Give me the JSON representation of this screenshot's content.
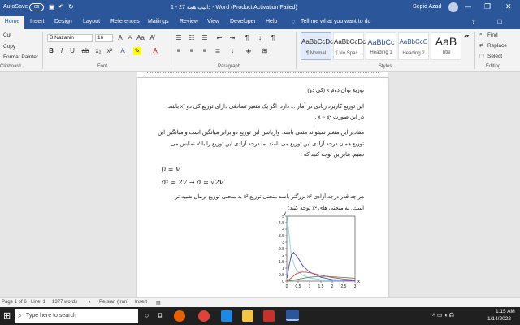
{
  "window": {
    "autosave_label": "AutoSave",
    "autosave_state": "Off",
    "title": "1 - ذاتیب همه 27 - Word (Product Activation Failed)",
    "user": "Sepid Azad"
  },
  "tabs": [
    "Home",
    "Insert",
    "Design",
    "Layout",
    "References",
    "Mailings",
    "Review",
    "View",
    "Developer",
    "Help"
  ],
  "tell_me": "Tell me what you want to do",
  "clipboard": {
    "cut": "Cut",
    "copy": "Copy",
    "format_painter": "Format Painter",
    "group": "Clipboard"
  },
  "font": {
    "name": "B Nazanin",
    "size": "16",
    "group": "Font"
  },
  "paragraph": {
    "group": "Paragraph"
  },
  "styles": {
    "group": "Styles",
    "items": [
      {
        "preview": "AaBbCcDc",
        "name": "¶ Normal"
      },
      {
        "preview": "AaBbCcDc",
        "name": "¶ No Spac..."
      },
      {
        "preview": "AaBbCc",
        "name": "Heading 1"
      },
      {
        "preview": "AaBbCcC",
        "name": "Heading 2"
      },
      {
        "preview": "AaB",
        "name": "Title"
      }
    ]
  },
  "editing": {
    "find": "Find",
    "replace": "Replace",
    "select": "Select",
    "group": "Editing"
  },
  "document": {
    "heading": "توزیع توان دوم k (کی دو)",
    "p1_line1": "این توزیع کاربرد زیادی در آمار ... دارد. اگر یک متغیر تصادفی دارای توزیع کی دو x² باشد",
    "p1_line2": "در این صورت x ~ χ² .",
    "p2_line1": "مقادیر این متغیر نمیتواند منفی باشد. واریانس این توزیع دو برابر میانگین است و میانگین این",
    "p2_line2": "توزیع همان درجه آزادی این توزیع می نامند. ما درجه آزادی این توزیع را با V نمایش می",
    "p2_line3": "دهیم. بنابراین توجه کنید که :",
    "eq1": "μ = V",
    "eq2": "σ² = 2V  →  σ = √2V",
    "p3_line1": "هر چه قدر درجه آزادی x² بزرگتر باشد منحنی توزیع x² به منحنی توزیع نرمال شبیه تر",
    "p3_line2": "است. به منحنی های x² توجه کنید:"
  },
  "chart_data": {
    "type": "line",
    "ylabel": "y",
    "xlabel": "x",
    "ylim": [
      0,
      5
    ],
    "xlim": [
      0,
      3
    ],
    "y_ticks": [
      "0",
      "0.5",
      "1",
      "1.5",
      "2",
      "2.5",
      "3",
      "3.5",
      "4",
      "4.5",
      "5"
    ],
    "x_ticks": [
      "0",
      "0.5",
      "1",
      "1.5",
      "2",
      "2.5",
      "3"
    ],
    "series": [
      {
        "color": "#7fd6e8",
        "values": [
          [
            0.02,
            5
          ],
          [
            0.1,
            3.6
          ],
          [
            0.2,
            1.9
          ],
          [
            0.4,
            0.9
          ],
          [
            0.7,
            0.45
          ],
          [
            1,
            0.25
          ],
          [
            1.5,
            0.12
          ],
          [
            2,
            0.06
          ],
          [
            3,
            0.02
          ]
        ]
      },
      {
        "color": "#3f48cc",
        "values": [
          [
            0.02,
            0.3
          ],
          [
            0.1,
            1.2
          ],
          [
            0.2,
            2.0
          ],
          [
            0.3,
            2.2
          ],
          [
            0.45,
            1.9
          ],
          [
            0.7,
            1.2
          ],
          [
            1,
            0.7
          ],
          [
            1.5,
            0.3
          ],
          [
            2,
            0.12
          ],
          [
            3,
            0.02
          ]
        ]
      },
      {
        "color": "#e04848",
        "values": [
          [
            0,
            0
          ],
          [
            0.2,
            0.25
          ],
          [
            0.4,
            0.55
          ],
          [
            0.6,
            0.68
          ],
          [
            0.8,
            0.7
          ],
          [
            1.1,
            0.62
          ],
          [
            1.5,
            0.45
          ],
          [
            2,
            0.28
          ],
          [
            2.5,
            0.16
          ],
          [
            3,
            0.09
          ]
        ]
      },
      {
        "color": "#5a8f5a",
        "values": [
          [
            0,
            0
          ],
          [
            0.3,
            0.08
          ],
          [
            0.6,
            0.18
          ],
          [
            1,
            0.3
          ],
          [
            1.4,
            0.36
          ],
          [
            1.8,
            0.36
          ],
          [
            2.2,
            0.32
          ],
          [
            2.6,
            0.27
          ],
          [
            3,
            0.22
          ]
        ]
      }
    ]
  },
  "status": {
    "page": "Page 1 of 6",
    "line": "Line: 1",
    "words": "1377 words",
    "language": "Persian (Iran)",
    "mode": "Insert"
  },
  "taskbar": {
    "search": "Type here to search",
    "time": "1:15 AM",
    "date": "1/14/2022"
  }
}
